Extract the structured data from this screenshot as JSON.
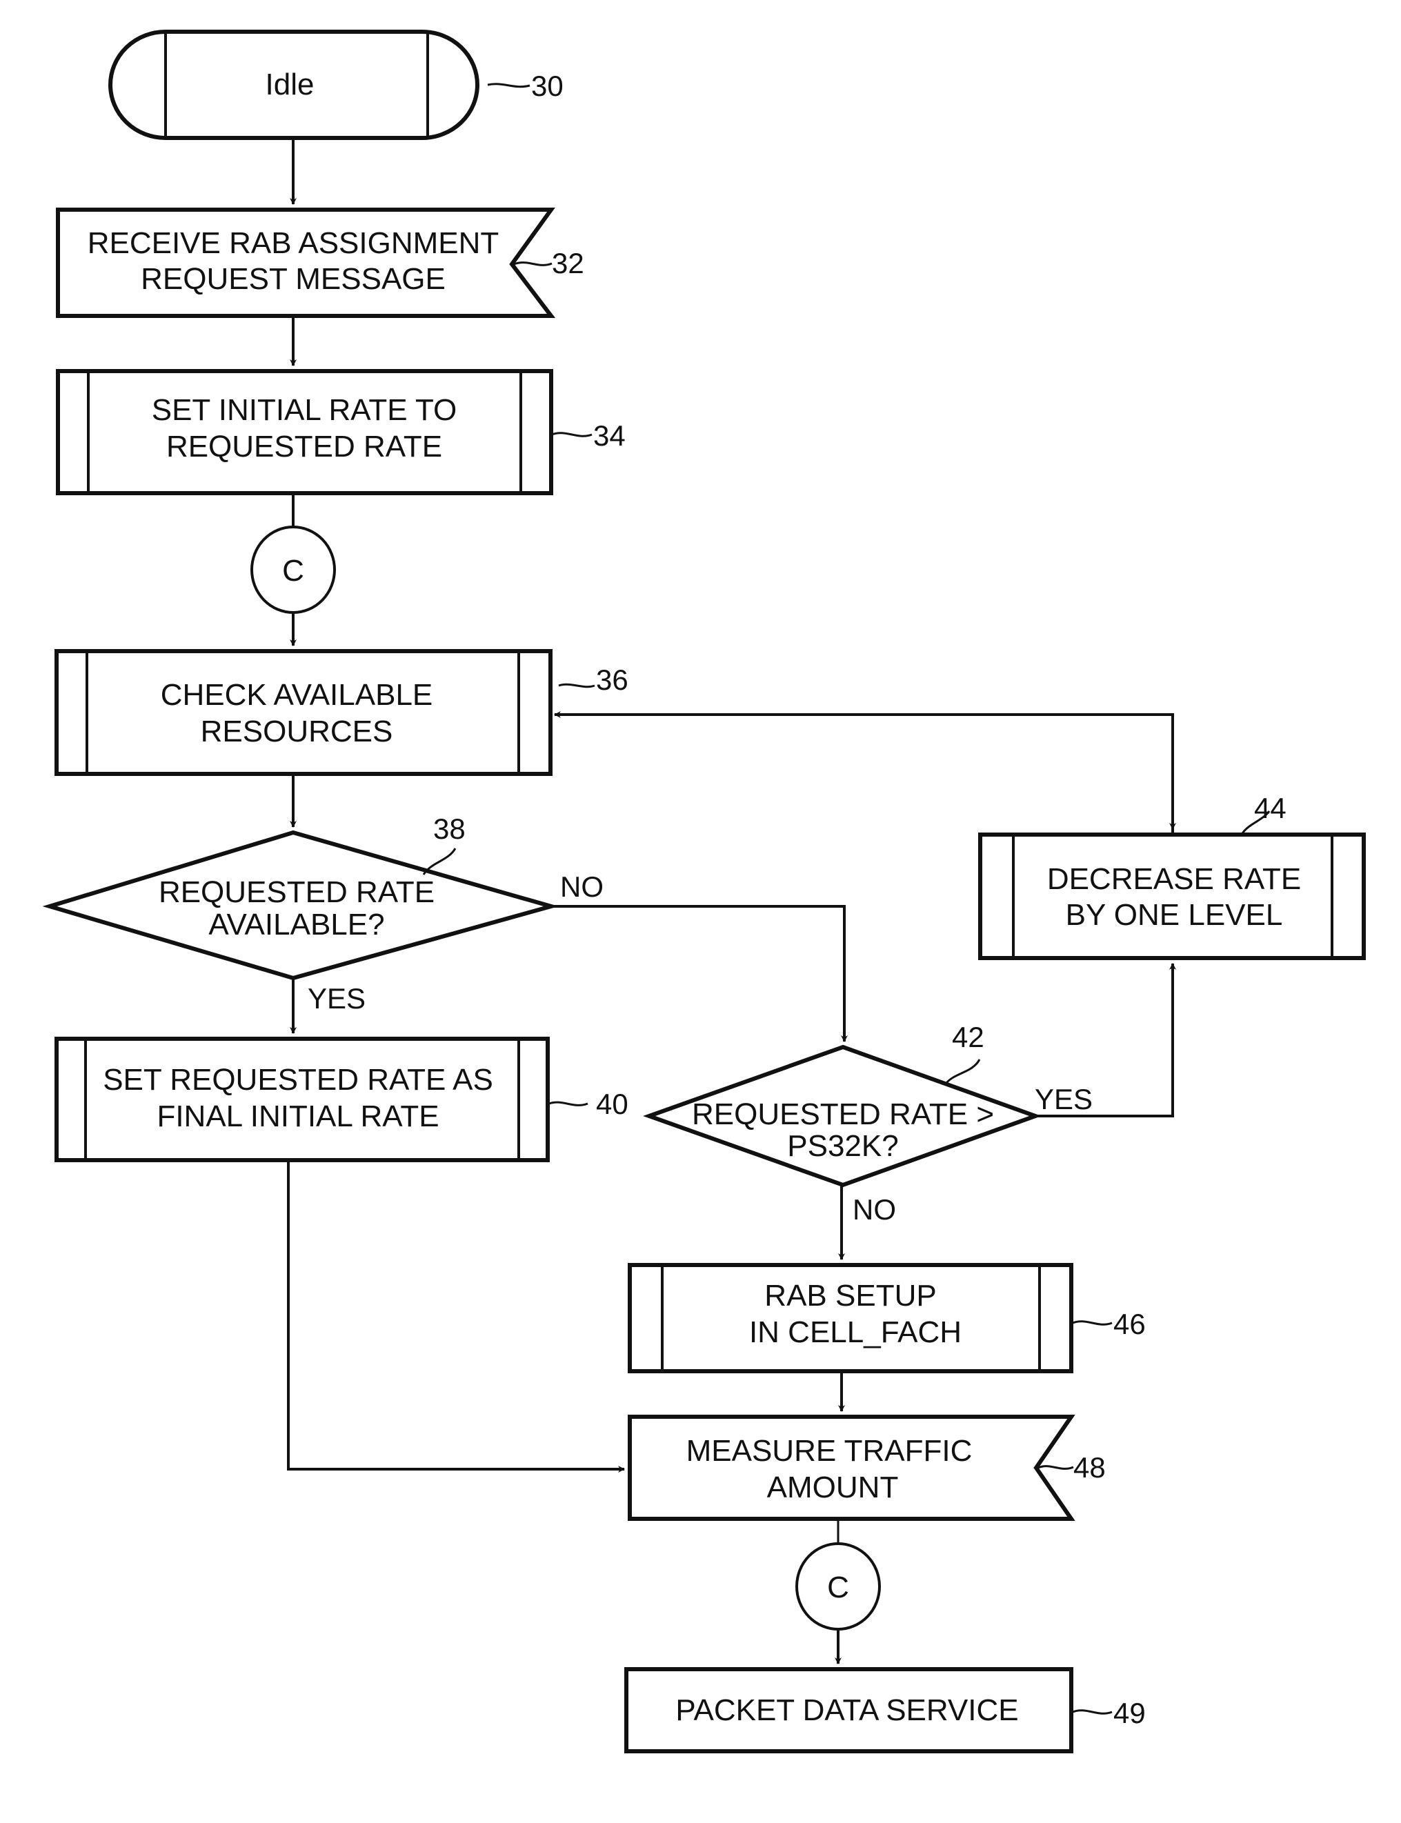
{
  "diagram": {
    "type": "flowchart",
    "colors": {
      "ink": "#111111",
      "background": "#ffffff"
    },
    "nodes": {
      "idle": {
        "ref": "30",
        "shape": "terminator",
        "lines": [
          "Idle"
        ]
      },
      "receive": {
        "ref": "32",
        "shape": "signal-input",
        "lines": [
          "RECEIVE RAB ASSIGNMENT",
          "REQUEST MESSAGE"
        ]
      },
      "set_initial": {
        "ref": "34",
        "shape": "predefined-process",
        "lines": [
          "SET INITIAL RATE TO",
          "REQUESTED RATE"
        ]
      },
      "connector_top": {
        "shape": "connector",
        "lines": [
          "C"
        ]
      },
      "check": {
        "ref": "36",
        "shape": "predefined-process",
        "lines": [
          "CHECK AVAILABLE",
          "RESOURCES"
        ]
      },
      "decision_available": {
        "ref": "38",
        "shape": "decision",
        "lines": [
          "REQUESTED RATE",
          "AVAILABLE?"
        ]
      },
      "set_final": {
        "ref": "40",
        "shape": "predefined-process",
        "lines": [
          "SET REQUESTED RATE AS",
          "FINAL INITIAL RATE"
        ]
      },
      "decision_ps32k": {
        "ref": "42",
        "shape": "decision",
        "lines": [
          "REQUESTED RATE >",
          "PS32K?"
        ]
      },
      "decrease": {
        "ref": "44",
        "shape": "predefined-process",
        "lines": [
          "DECREASE RATE",
          "BY ONE LEVEL"
        ]
      },
      "rab_setup": {
        "ref": "46",
        "shape": "predefined-process",
        "lines": [
          "RAB SETUP",
          "IN CELL_FACH"
        ]
      },
      "measure": {
        "ref": "48",
        "shape": "signal-input",
        "lines": [
          "MEASURE TRAFFIC",
          "AMOUNT"
        ]
      },
      "connector_bottom": {
        "shape": "connector",
        "lines": [
          "C"
        ]
      },
      "packet": {
        "ref": "49",
        "shape": "process",
        "lines": [
          "PACKET DATA SERVICE"
        ]
      }
    },
    "branch_labels": {
      "available_no": "NO",
      "available_yes": "YES",
      "ps32k_yes": "YES",
      "ps32k_no": "NO"
    },
    "edges": [
      [
        "idle",
        "receive"
      ],
      [
        "receive",
        "set_initial"
      ],
      [
        "set_initial",
        "connector_top"
      ],
      [
        "connector_top",
        "check"
      ],
      [
        "check",
        "decision_available"
      ],
      [
        "decision_available",
        "set_final",
        "YES"
      ],
      [
        "decision_available",
        "decision_ps32k",
        "NO"
      ],
      [
        "decision_ps32k",
        "decrease",
        "YES"
      ],
      [
        "decrease",
        "check"
      ],
      [
        "decision_ps32k",
        "rab_setup",
        "NO"
      ],
      [
        "set_final",
        "measure"
      ],
      [
        "rab_setup",
        "measure"
      ],
      [
        "measure",
        "connector_bottom"
      ],
      [
        "connector_bottom",
        "packet"
      ]
    ]
  }
}
